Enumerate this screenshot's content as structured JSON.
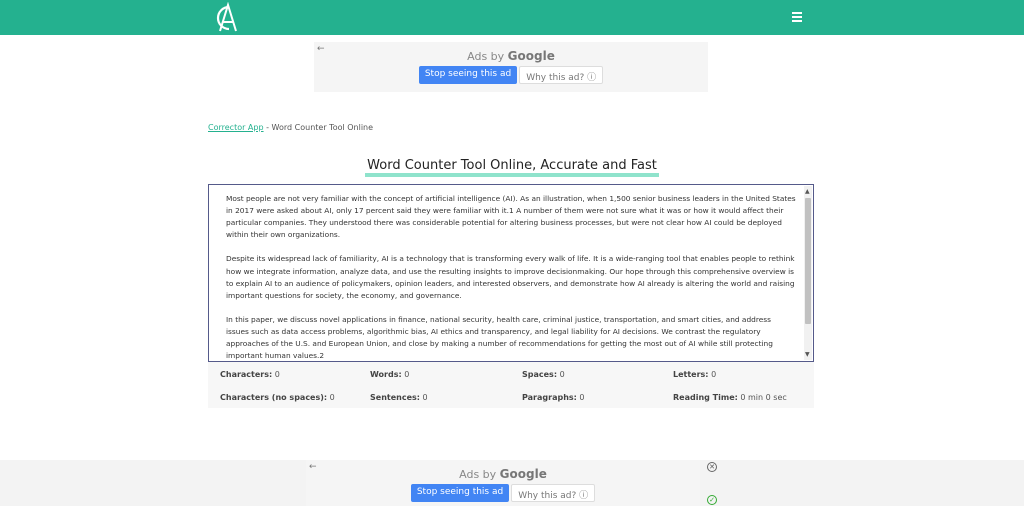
{
  "header": {
    "menu_icon": "hamburger-menu-icon",
    "brand_color": "#24b18f"
  },
  "ad_top": {
    "ads_by": "Ads by",
    "google": "Google",
    "stop_label": "Stop seeing this ad",
    "why_label": "Why this ad? ⓘ"
  },
  "ad_bottom": {
    "ads_by": "Ads by",
    "google": "Google",
    "stop_label": "Stop seeing this ad",
    "why_label": "Why this ad? ⓘ"
  },
  "breadcrumb": {
    "link": "Corrector App",
    "separator": " - ",
    "current": "Word Counter Tool Online"
  },
  "title": "Word Counter Tool Online, Accurate and Fast",
  "editor": {
    "paragraphs": [
      "Most people are not very familiar with the concept of artificial intelligence (AI). As an illustration, when 1,500 senior business leaders in the United States in 2017 were asked about AI, only 17 percent said they were familiar with it.1 A number of them were not sure what it was or how it would affect their particular companies. They understood there was considerable potential for altering business processes, but were not clear how AI could be deployed within their own organizations.",
      "Despite its widespread lack of familiarity, AI is a technology that is transforming every walk of life. It is a wide-ranging tool that enables people to rethink how we integrate information, analyze data, and use the resulting insights to improve decisionmaking. Our hope through this comprehensive overview is to explain AI to an audience of policymakers, opinion leaders, and interested observers, and demonstrate how AI already is altering the world and raising important questions for society, the economy, and governance.",
      "In this paper, we discuss novel applications in finance, national security, health care, criminal justice, transportation, and smart cities, and address issues such as data access problems, algorithmic bias, AI ethics and transparency, and legal liability for AI decisions. We contrast the regulatory approaches of the U.S. and European Union, and close by making a number of recommendations for getting the most out of AI while still protecting important human values.2"
    ]
  },
  "stats": {
    "characters_label": "Characters:",
    "characters_value": "0",
    "words_label": "Words:",
    "words_value": "0",
    "spaces_label": "Spaces:",
    "spaces_value": "0",
    "letters_label": "Letters:",
    "letters_value": "0",
    "chars_nospace_label": "Characters (no spaces):",
    "chars_nospace_value": "0",
    "sentences_label": "Sentences:",
    "sentences_value": "0",
    "paragraphs_label": "Paragraphs:",
    "paragraphs_value": "0",
    "reading_label": "Reading Time:",
    "reading_value": "0 min 0 sec"
  }
}
